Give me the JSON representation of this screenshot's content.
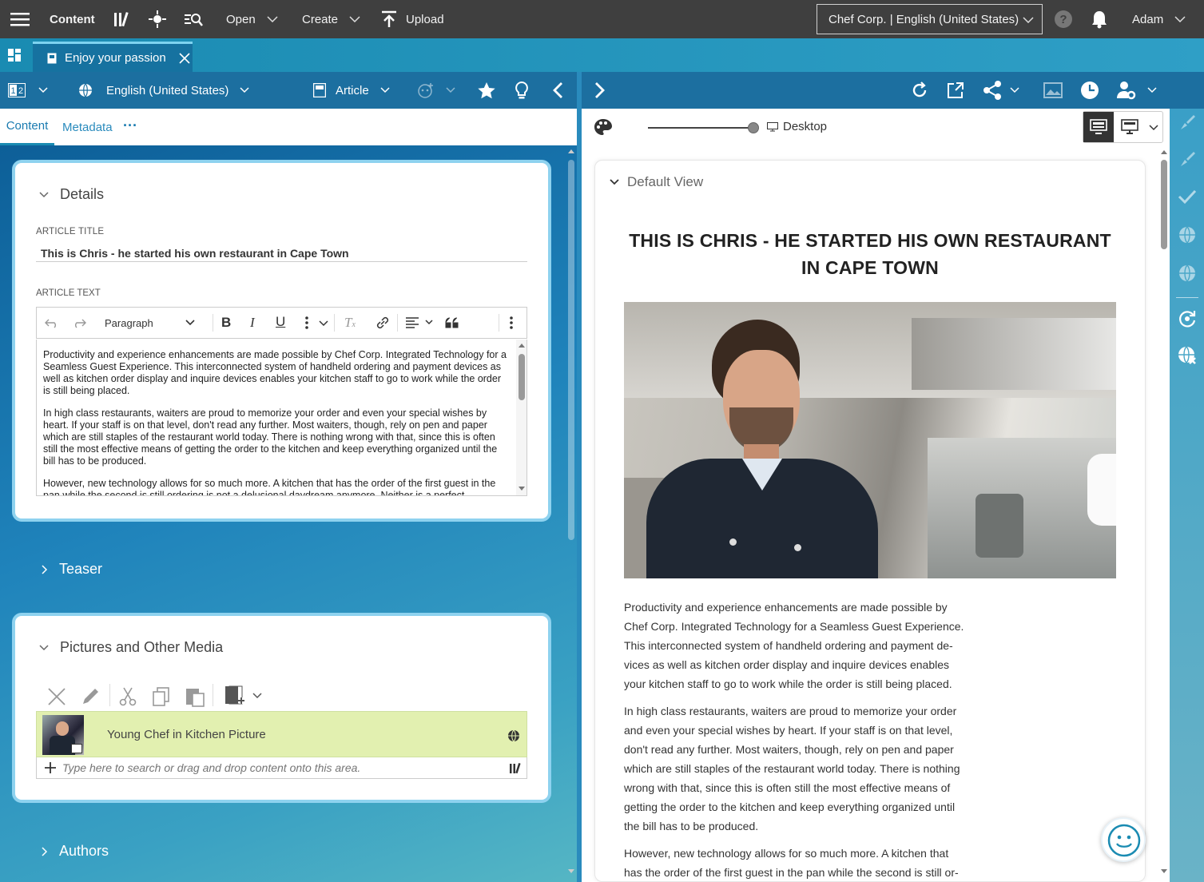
{
  "topbar": {
    "menu_icon": "hamburger-icon",
    "app_label": "Content",
    "open_label": "Open",
    "create_label": "Create",
    "upload_label": "Upload",
    "site_selector": "Chef Corp. | English (United States)",
    "user": "Adam"
  },
  "tabs": [
    {
      "label": "Enjoy your passion"
    }
  ],
  "left_toolbar": {
    "locale": "English (United States)",
    "doc_type": "Article"
  },
  "subtabs": {
    "content": "Content",
    "metadata": "Metadata",
    "more": "···"
  },
  "details": {
    "title": "Details",
    "article_title_label": "ARTICLE TITLE",
    "article_title_value": "This is Chris - he started his own restaurant in Cape Town",
    "article_text_label": "ARTICLE TEXT",
    "paragraph_style": "Paragraph",
    "paragraphs": [
      "Productivity and experience enhancements are made possible by Chef Corp. Integrated Technology for a Seamless Guest Experience. This interconnected system of handheld ordering and payment devices as well as kitchen order display and inquire devices enables your kitchen staff to go to work while the order is still being placed.",
      "In high class restaurants, waiters are proud to memorize your order and even your special wishes by heart. If your staff is on that level, don't read any further. Most waiters, though, rely on pen and paper which are still staples of the restaurant world today. There is nothing wrong with that, since this is often still the most effective means of getting the order to the kitchen and keep everything organized until the bill has to be produced.",
      "However, new technology allows for so much more. A kitchen that has the order of the first guest in the pan while the second is still ordering is not a delusional daydream anymore. Neither is a perfect"
    ]
  },
  "teaser": {
    "title": "Teaser"
  },
  "media": {
    "title": "Pictures and Other Media",
    "item_label": "Young Chef in Kitchen Picture",
    "search_placeholder": "Type here to search or drag and drop content onto this area."
  },
  "authors": {
    "title": "Authors"
  },
  "preview": {
    "device_label": "Desktop",
    "view_title": "Default View",
    "headline": "THIS IS CHRIS - HE STARTED HIS OWN RESTAURANT IN CAPE TOWN",
    "paragraphs": [
      "Productivity and experience enhancements are made possible by Chef Corp. Integrated Technology for a Seamless Guest Experience. This interconnected system of handheld ordering and payment de-vices as well as kitchen order display and inquire devices enables your kitchen staff to go to work while the order is still being placed.",
      "In high class restaurants, waiters are proud to memorize your order and even your special wishes by heart. If your staff is on that level, don't read any further. Most waiters, though, rely on pen and paper which are still staples of the restaurant world today. There is nothing wrong with that, since this is often still the most effective means of getting the order to the kitchen and keep everything organized until the bill has to be produced.",
      "However, new technology allows for so much more. A kitchen that has the order of the first guest in the pan while the second is still or-"
    ]
  },
  "colors": {
    "topbar": "#3f3f3f",
    "tabbar": "#1a8bb2",
    "toolbar": "#1c6fa0",
    "accent": "#1a8bb2",
    "media_item_bg": "#e2f0b0"
  }
}
